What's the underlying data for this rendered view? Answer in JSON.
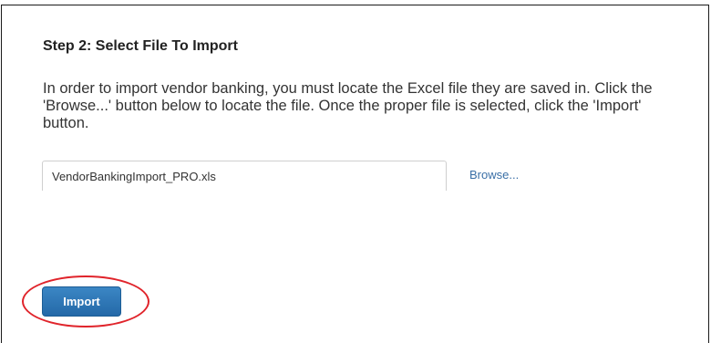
{
  "step": {
    "title": "Step 2: Select File To Import",
    "instructions": "In order to import vendor banking, you must locate the Excel file they are saved in. Click the 'Browse...' button below to locate the file. Once the proper file is selected, click the 'Import' button."
  },
  "file_input": {
    "value": "VendorBankingImport_PRO.xls"
  },
  "browse": {
    "label": "Browse..."
  },
  "import": {
    "label": "Import"
  },
  "colors": {
    "link": "#3a6fa6",
    "button": "#2a72b5",
    "highlight": "#e0242b"
  }
}
